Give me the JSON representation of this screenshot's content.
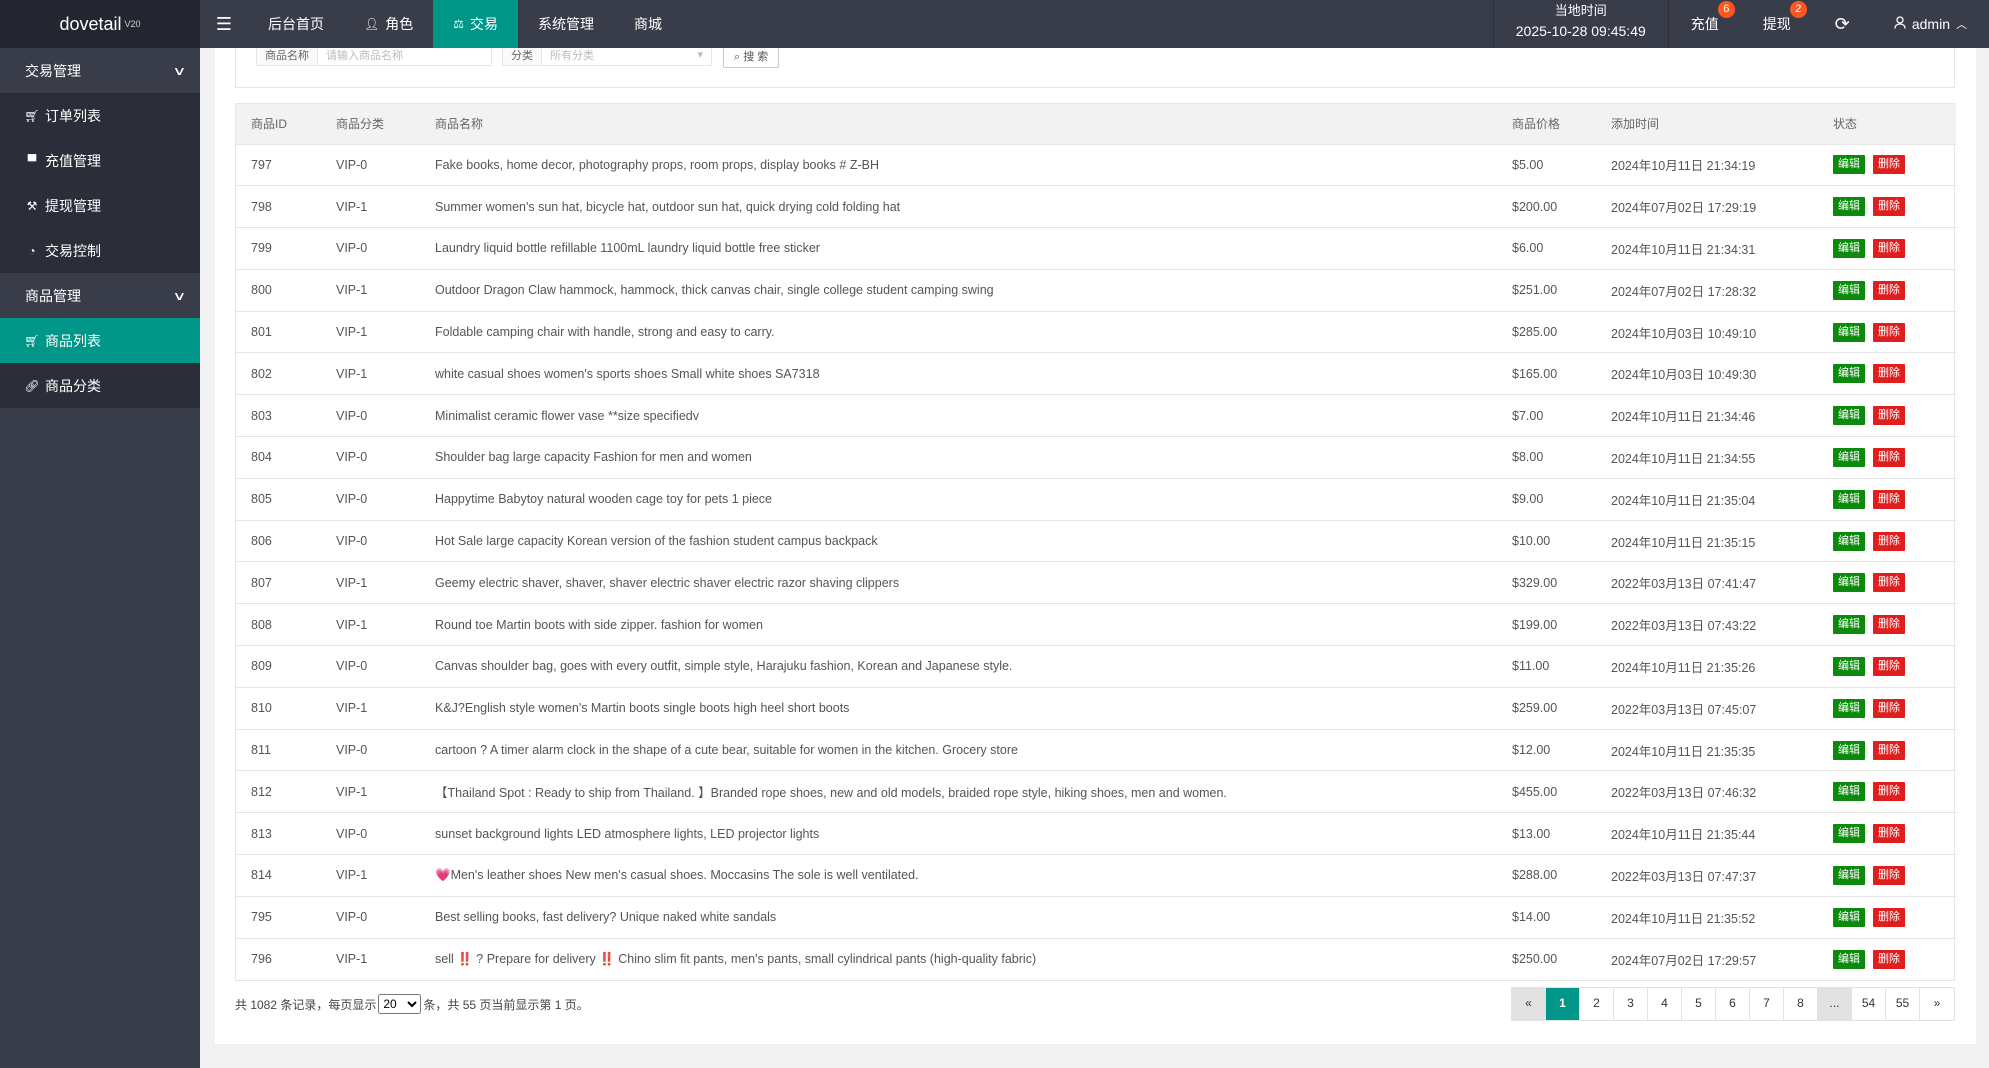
{
  "app": {
    "brand": "dovetail",
    "version": "V20"
  },
  "topnav": [
    {
      "label": "后台首页",
      "icon": "",
      "active": false
    },
    {
      "label": "角色",
      "icon": "user-icon",
      "active": false
    },
    {
      "label": "交易",
      "icon": "scale-icon",
      "active": true
    },
    {
      "label": "系统管理",
      "icon": "",
      "active": false
    },
    {
      "label": "商城",
      "icon": "",
      "active": false
    }
  ],
  "header_right": {
    "clock_label": "当地时间",
    "clock_time": "2025-10-28 09:45:49",
    "recharge_label": "充值",
    "recharge_badge": "6",
    "withdraw_label": "提现",
    "withdraw_badge": "2",
    "user": "admin"
  },
  "sidebar": {
    "group1": "交易管理",
    "group1_items": [
      "订单列表",
      "充值管理",
      "提现管理",
      "交易控制"
    ],
    "group2": "商品管理",
    "group2_items": [
      "商品列表",
      "商品分类"
    ]
  },
  "search": {
    "name_label": "商品名称",
    "name_placeholder": "请输入商品名称",
    "cat_label": "分类",
    "cat_value": "所有分类",
    "search_button": "搜 索"
  },
  "table": {
    "headers": [
      "商品ID",
      "商品分类",
      "商品名称",
      "商品价格",
      "添加时间",
      "状态"
    ],
    "edit_label": "编辑",
    "delete_label": "删除",
    "rows": [
      [
        "797",
        "VIP-0",
        "Fake books, home decor, photography props, room props, display books # Z-BH",
        "$5.00",
        "2024年10月11日 21:34:19"
      ],
      [
        "798",
        "VIP-1",
        "Summer women's sun hat, bicycle hat, outdoor sun hat, quick drying cold folding hat",
        "$200.00",
        "2024年07月02日 17:29:19"
      ],
      [
        "799",
        "VIP-0",
        "Laundry liquid bottle refillable 1100mL laundry liquid bottle free sticker",
        "$6.00",
        "2024年10月11日 21:34:31"
      ],
      [
        "800",
        "VIP-1",
        "Outdoor Dragon Claw hammock, hammock, thick canvas chair, single college student camping swing",
        "$251.00",
        "2024年07月02日 17:28:32"
      ],
      [
        "801",
        "VIP-1",
        "Foldable camping chair with handle, strong and easy to carry.",
        "$285.00",
        "2024年10月03日 10:49:10"
      ],
      [
        "802",
        "VIP-1",
        "white casual shoes women's sports shoes Small white shoes SA7318",
        "$165.00",
        "2024年10月03日 10:49:30"
      ],
      [
        "803",
        "VIP-0",
        "Minimalist ceramic flower vase **size specifiedv",
        "$7.00",
        "2024年10月11日 21:34:46"
      ],
      [
        "804",
        "VIP-0",
        "Shoulder bag large capacity Fashion for men and women",
        "$8.00",
        "2024年10月11日 21:34:55"
      ],
      [
        "805",
        "VIP-0",
        "Happytime Babytoy natural wooden cage toy for pets 1 piece",
        "$9.00",
        "2024年10月11日 21:35:04"
      ],
      [
        "806",
        "VIP-0",
        "Hot Sale large capacity Korean version of the fashion student campus backpack",
        "$10.00",
        "2024年10月11日 21:35:15"
      ],
      [
        "807",
        "VIP-1",
        "Geemy electric shaver, shaver, shaver electric shaver electric razor shaving clippers",
        "$329.00",
        "2022年03月13日 07:41:47"
      ],
      [
        "808",
        "VIP-1",
        "Round toe Martin boots with side zipper. fashion for women",
        "$199.00",
        "2022年03月13日 07:43:22"
      ],
      [
        "809",
        "VIP-0",
        "Canvas shoulder bag, goes with every outfit, simple style, Harajuku fashion, Korean and Japanese style.",
        "$11.00",
        "2024年10月11日 21:35:26"
      ],
      [
        "810",
        "VIP-1",
        "K&J?English style women's Martin boots single boots high heel short boots",
        "$259.00",
        "2022年03月13日 07:45:07"
      ],
      [
        "811",
        "VIP-0",
        "cartoon ? A timer alarm clock in the shape of a cute bear, suitable for women in the kitchen. Grocery store",
        "$12.00",
        "2024年10月11日 21:35:35"
      ],
      [
        "812",
        "VIP-1",
        "【Thailand Spot : Ready to ship from Thailand. 】Branded rope shoes, new and old models, braided rope style, hiking shoes, men and women.",
        "$455.00",
        "2022年03月13日 07:46:32"
      ],
      [
        "813",
        "VIP-0",
        "sunset background lights LED atmosphere lights, LED projector lights",
        "$13.00",
        "2024年10月11日 21:35:44"
      ],
      [
        "814",
        "VIP-1",
        "💗Men's leather shoes New men's casual shoes. Moccasins The sole is well ventilated.",
        "$288.00",
        "2022年03月13日 07:47:37"
      ],
      [
        "795",
        "VIP-0",
        "Best selling books, fast delivery? Unique naked white sandals",
        "$14.00",
        "2024年10月11日 21:35:52"
      ],
      [
        "796",
        "VIP-1",
        "sell ‼️ ? Prepare for delivery ‼️ Chino slim fit pants, men's pants, small cylindrical pants (high-quality fabric)",
        "$250.00",
        "2024年07月02日 17:29:57"
      ]
    ]
  },
  "footer": {
    "prefix": "共 1082 条记录，每页显示",
    "per_page": "20",
    "suffix": "条，共 55 页当前显示第 1 页。",
    "pages": [
      "«",
      "1",
      "2",
      "3",
      "4",
      "5",
      "6",
      "7",
      "8",
      "...",
      "54",
      "55",
      "»"
    ]
  },
  "colors": {
    "accent": "#009688",
    "dark": "#393d49",
    "edit": "#0b8a0b",
    "delete": "#e01e1e",
    "badge": "#ff5722"
  }
}
